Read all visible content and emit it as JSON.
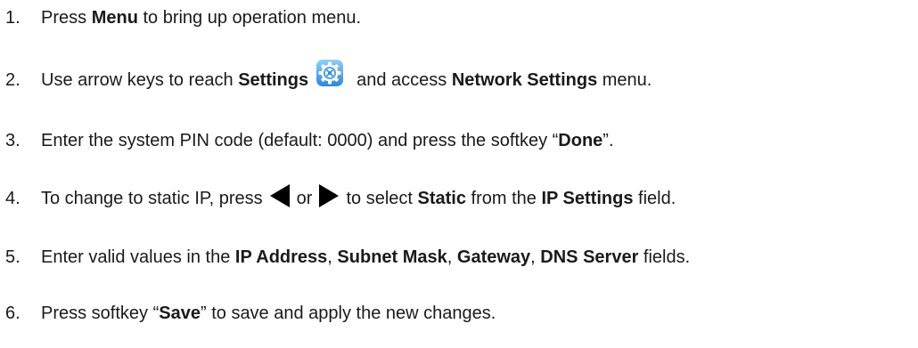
{
  "steps": [
    {
      "number": "1.",
      "parts": [
        {
          "t": "Press ",
          "b": false
        },
        {
          "t": "Menu",
          "b": true
        },
        {
          "t": " to bring up operation menu.",
          "b": false
        }
      ]
    },
    {
      "number": "2.",
      "parts_before_icon": [
        {
          "t": "Use arrow keys to reach ",
          "b": false
        },
        {
          "t": "Settings",
          "b": true
        }
      ],
      "icon": "settings-gear-icon",
      "parts_after_icon": [
        {
          "t": "and access ",
          "b": false
        },
        {
          "t": "Network Settings",
          "b": true
        },
        {
          "t": " menu.",
          "b": false
        }
      ]
    },
    {
      "number": "3.",
      "parts": [
        {
          "t": "Enter the system PIN code (default: 0000) and press the softkey “",
          "b": false
        },
        {
          "t": "Done",
          "b": true
        },
        {
          "t": "”.",
          "b": false
        }
      ]
    },
    {
      "number": "4.",
      "parts_before_left": [
        {
          "t": "To change to static IP, press",
          "b": false
        }
      ],
      "left_icon": "left-arrow-icon",
      "between": "or",
      "right_icon": "right-arrow-icon",
      "parts_after_right": [
        {
          "t": "to select ",
          "b": false
        },
        {
          "t": "Static",
          "b": true
        },
        {
          "t": " from the ",
          "b": false
        },
        {
          "t": "IP Settings",
          "b": true
        },
        {
          "t": " field.",
          "b": false
        }
      ]
    },
    {
      "number": "5.",
      "parts": [
        {
          "t": "Enter valid values in the ",
          "b": false
        },
        {
          "t": "IP Address",
          "b": true
        },
        {
          "t": ", ",
          "b": false
        },
        {
          "t": "Subnet Mask",
          "b": true
        },
        {
          "t": ", ",
          "b": false
        },
        {
          "t": "Gateway",
          "b": true
        },
        {
          "t": ", ",
          "b": false
        },
        {
          "t": "DNS Server",
          "b": true
        },
        {
          "t": " fields.",
          "b": false
        }
      ]
    },
    {
      "number": "6.",
      "parts": [
        {
          "t": "Press softkey “",
          "b": false
        },
        {
          "t": "Save",
          "b": true
        },
        {
          "t": "” to save and apply the new changes.",
          "b": false
        }
      ]
    }
  ],
  "colors": {
    "text": "#1a1a1a",
    "icon_blue_dark": "#2e7fd6",
    "icon_blue_light": "#7ec3f2"
  }
}
